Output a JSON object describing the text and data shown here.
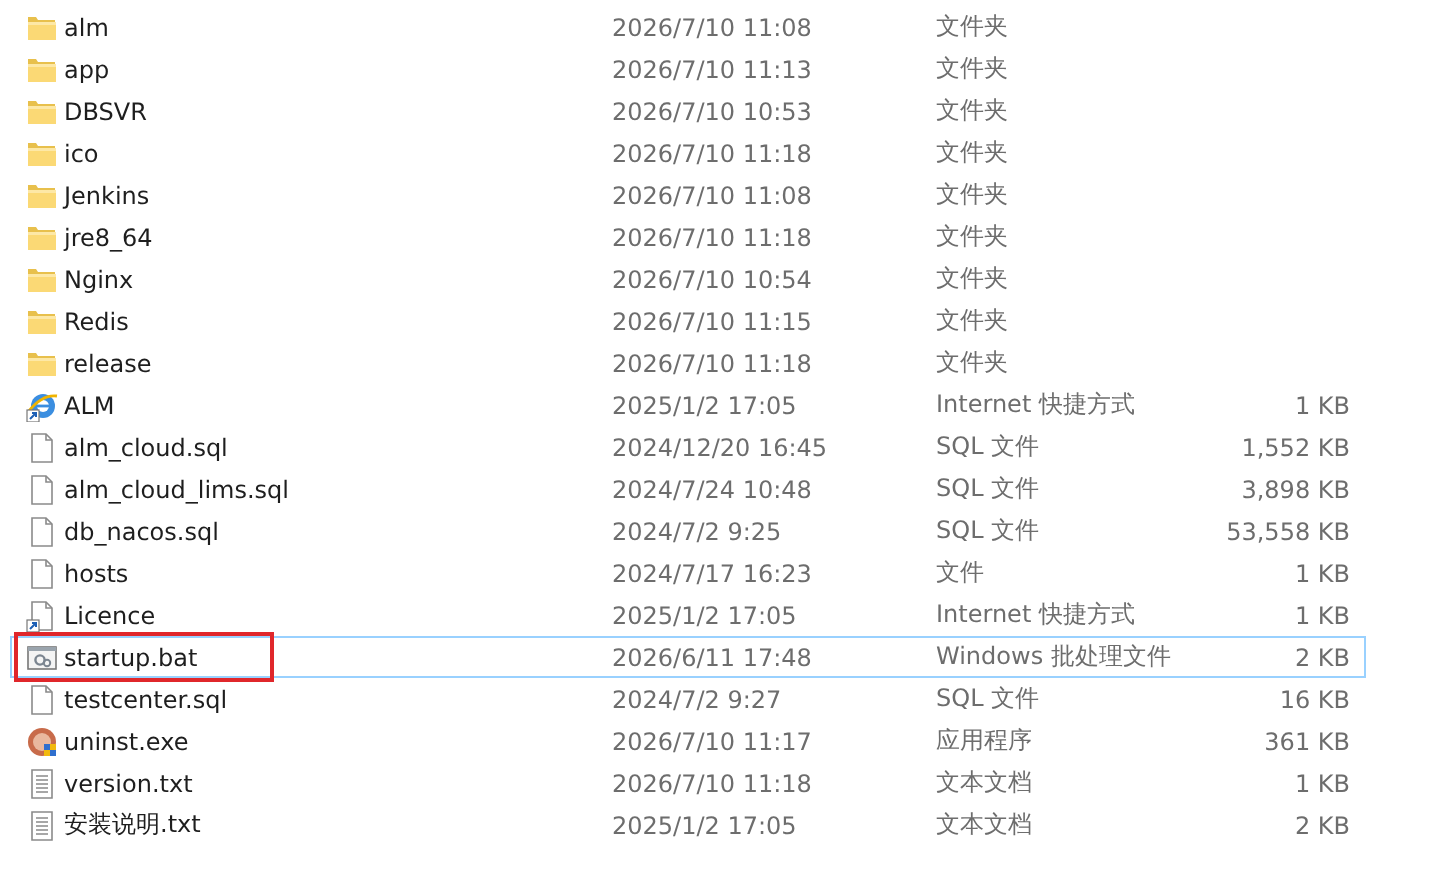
{
  "files": [
    {
      "name": "alm",
      "modified": "2026/7/10 11:08",
      "type": "文件夹",
      "kind": "folder",
      "focused": false,
      "highlighted": false
    },
    {
      "name": "app",
      "modified": "2026/7/10 11:13",
      "type": "文件夹",
      "kind": "folder",
      "focused": false,
      "highlighted": false
    },
    {
      "name": "DBSVR",
      "modified": "2026/7/10 10:53",
      "type": "文件夹",
      "kind": "folder",
      "focused": false,
      "highlighted": false
    },
    {
      "name": "ico",
      "modified": "2026/7/10 11:18",
      "type": "文件夹",
      "kind": "folder",
      "focused": false,
      "highlighted": false
    },
    {
      "name": "Jenkins",
      "modified": "2026/7/10 11:08",
      "type": "文件夹",
      "kind": "folder",
      "focused": false,
      "highlighted": false
    },
    {
      "name": "jre8_64",
      "modified": "2026/7/10 11:18",
      "type": "文件夹",
      "kind": "folder",
      "focused": false,
      "highlighted": false
    },
    {
      "name": "Nginx",
      "modified": "2026/7/10 10:54",
      "type": "文件夹",
      "kind": "folder",
      "focused": false,
      "highlighted": false
    },
    {
      "name": "Redis",
      "modified": "2026/7/10 11:15",
      "type": "文件夹",
      "kind": "folder",
      "focused": false,
      "highlighted": false
    },
    {
      "name": "release",
      "modified": "2026/7/10 11:18",
      "type": "文件夹",
      "kind": "folder",
      "focused": false,
      "highlighted": false
    },
    {
      "name": "ALM",
      "modified": "2025/1/2 17:05",
      "type": "Internet 快捷方式",
      "size": "1 KB",
      "kind": "web-shortcut",
      "focused": false,
      "highlighted": false
    },
    {
      "name": "alm_cloud.sql",
      "modified": "2024/12/20 16:45",
      "type": "SQL 文件",
      "size": "1,552 KB",
      "kind": "file",
      "focused": false,
      "highlighted": false
    },
    {
      "name": "alm_cloud_lims.sql",
      "modified": "2024/7/24 10:48",
      "type": "SQL 文件",
      "size": "3,898 KB",
      "kind": "file",
      "focused": false,
      "highlighted": false
    },
    {
      "name": "db_nacos.sql",
      "modified": "2024/7/2 9:25",
      "type": "SQL 文件",
      "size": "53,558 KB",
      "kind": "file",
      "focused": false,
      "highlighted": false
    },
    {
      "name": "hosts",
      "modified": "2024/7/17 16:23",
      "type": "文件",
      "size": "1 KB",
      "kind": "file",
      "focused": false,
      "highlighted": false
    },
    {
      "name": "Licence",
      "modified": "2025/1/2 17:05",
      "type": "Internet 快捷方式",
      "size": "1 KB",
      "kind": "file-shortcut",
      "focused": false,
      "highlighted": false
    },
    {
      "name": "startup.bat",
      "modified": "2026/6/11 17:48",
      "type": "Windows 批处理文件",
      "size": "2 KB",
      "kind": "batch",
      "focused": true,
      "highlighted": true
    },
    {
      "name": "testcenter.sql",
      "modified": "2024/7/2 9:27",
      "type": "SQL 文件",
      "size": "16 KB",
      "kind": "file",
      "focused": false,
      "highlighted": false
    },
    {
      "name": "uninst.exe",
      "modified": "2026/7/10 11:17",
      "type": "应用程序",
      "size": "361 KB",
      "kind": "program",
      "focused": false,
      "highlighted": false
    },
    {
      "name": "version.txt",
      "modified": "2026/7/10 11:18",
      "type": "文本文档",
      "size": "1 KB",
      "kind": "text",
      "focused": false,
      "highlighted": false
    },
    {
      "name": "安装说明.txt",
      "modified": "2025/1/2 17:05",
      "type": "文本文档",
      "size": "2 KB",
      "kind": "text",
      "focused": false,
      "highlighted": false
    }
  ]
}
